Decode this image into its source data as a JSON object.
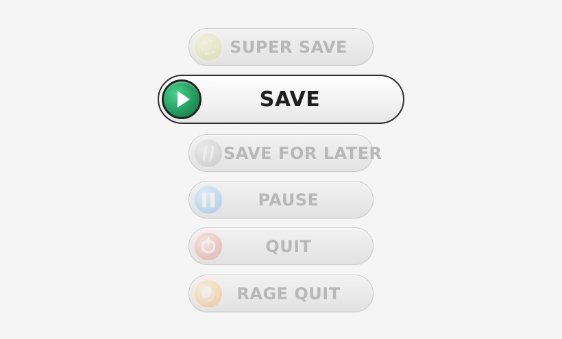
{
  "menu": {
    "items": [
      {
        "id": "super-save",
        "label": "SUPER SAVE",
        "state": "inactive",
        "icon": "sparkle-icon"
      },
      {
        "id": "save",
        "label": "SAVE",
        "state": "active",
        "icon": "play-icon"
      },
      {
        "id": "save-for-later",
        "label": "SAVE FOR LATER",
        "state": "inactive",
        "icon": "later-icon"
      },
      {
        "id": "pause",
        "label": "PAUSE",
        "state": "inactive",
        "icon": "pause-icon"
      },
      {
        "id": "quit",
        "label": "QUIT",
        "state": "inactive",
        "icon": "power-icon"
      },
      {
        "id": "rage-quit",
        "label": "RAGE QUIT",
        "state": "inactive",
        "icon": "flame-icon"
      }
    ]
  },
  "colors": {
    "background": "#f5f5f5",
    "inactive_text": "#b7b7b7",
    "active_text": "#1b1b1b",
    "active_outline": "#2a2a2a",
    "play_green": "#1e9a5b"
  }
}
